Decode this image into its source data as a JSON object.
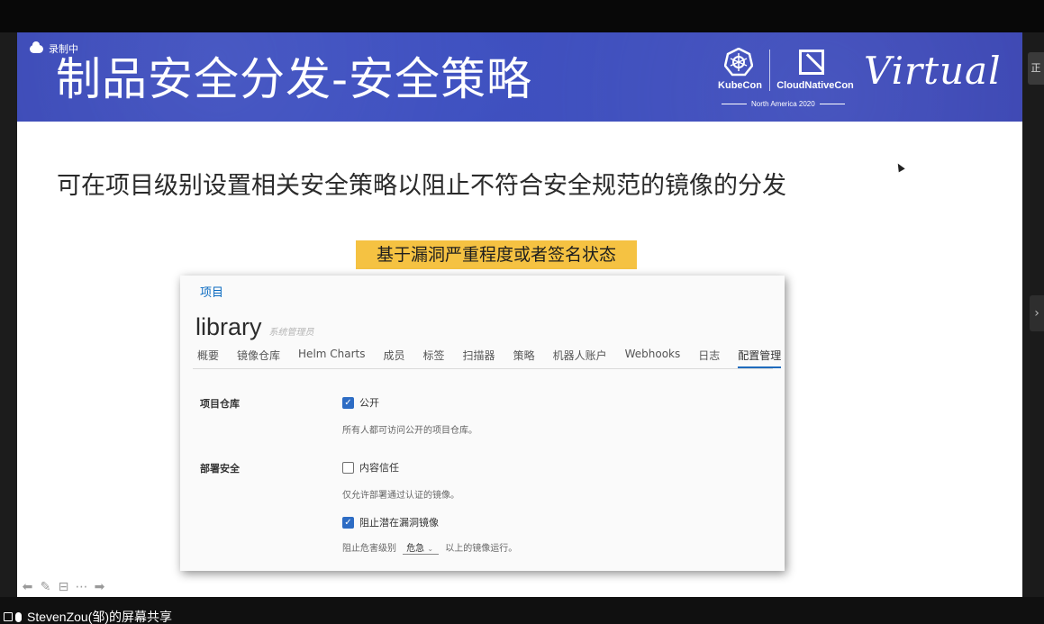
{
  "recording_label": "录制中",
  "slide": {
    "title": "制品安全分发-安全策略",
    "conference": {
      "kubecon": "KubeCon",
      "cloudnativecon": "CloudNativeCon",
      "edition": "North America 2020",
      "virtual": "Virtual"
    },
    "subtitle": "可在项目级别设置相关安全策略以阻止不符合安全规范的镜像的分发",
    "highlight": "基于漏洞严重程度或者签名状态"
  },
  "harbor": {
    "breadcrumb": "项目",
    "project_name": "library",
    "role": "系统管理员",
    "tabs": [
      {
        "label": "概要"
      },
      {
        "label": "镜像仓库"
      },
      {
        "label": "Helm Charts"
      },
      {
        "label": "成员"
      },
      {
        "label": "标签"
      },
      {
        "label": "扫描器"
      },
      {
        "label": "策略"
      },
      {
        "label": "机器人账户"
      },
      {
        "label": "Webhooks"
      },
      {
        "label": "日志"
      },
      {
        "label": "配置管理"
      }
    ],
    "active_tab": "配置管理",
    "sections": {
      "registry_label": "项目仓库",
      "public_label": "公开",
      "public_checked": true,
      "public_help": "所有人都可访问公开的项目仓库。",
      "deploy_label": "部署安全",
      "content_trust_label": "内容信任",
      "content_trust_checked": false,
      "content_trust_help": "仅允许部署通过认证的镜像。",
      "prevent_vuln_label": "阻止潜在漏洞镜像",
      "prevent_vuln_checked": true,
      "severity_prefix": "阻止危害级别",
      "severity_value": "危急",
      "severity_suffix": "以上的镜像运行。"
    }
  },
  "screen_share_label": "StevenZou(邹)的屏幕共享",
  "colors": {
    "header": "#3d4fbf",
    "highlight": "#f5c242",
    "link": "#0a6ac0",
    "checkbox": "#2d6cc4"
  }
}
